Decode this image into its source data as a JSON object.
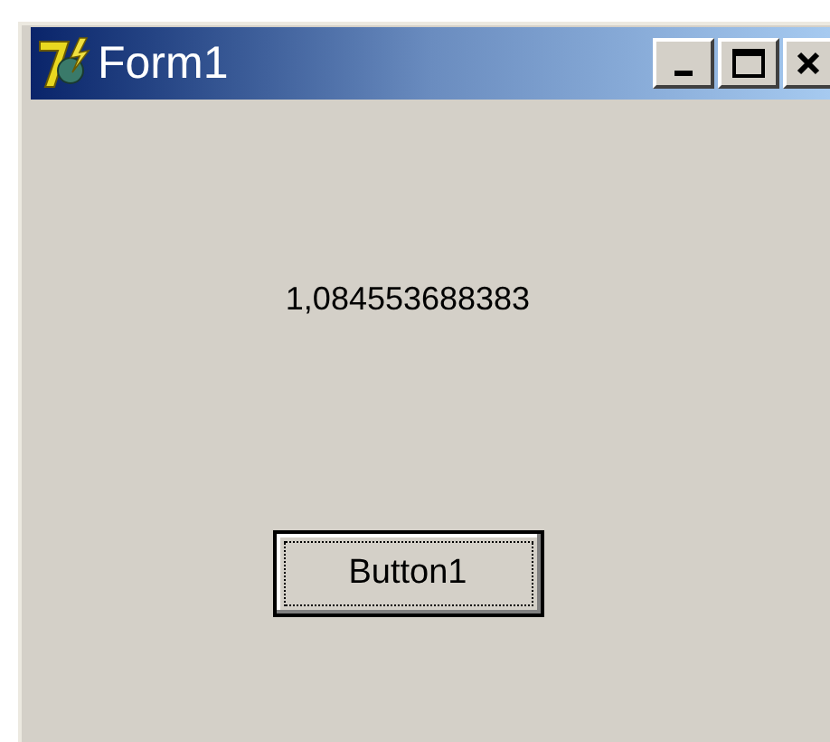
{
  "window": {
    "title": "Form1"
  },
  "label": "1,084553688383",
  "button": {
    "label": "Button1",
    "focused": true
  }
}
